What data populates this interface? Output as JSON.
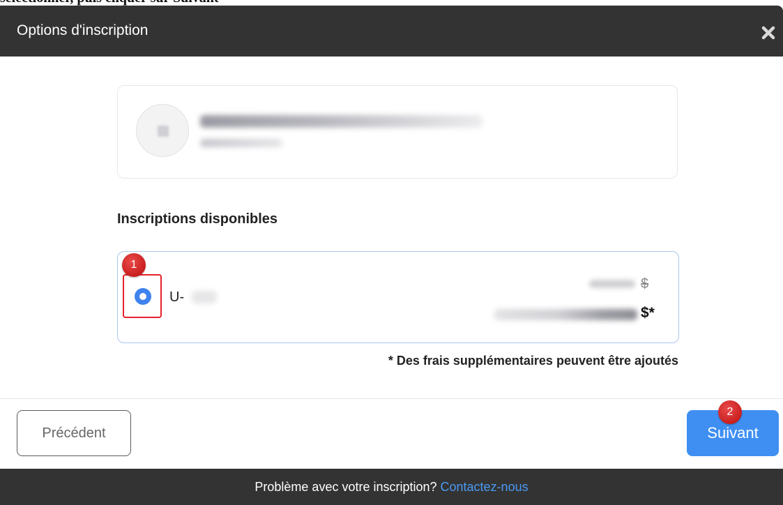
{
  "top_strip": {
    "text": "sélectionner, puis cliquer sur Suivant"
  },
  "modal": {
    "title": "Options d'inscription",
    "close_icon": "close-icon"
  },
  "user_card": {
    "avatar_icon": "avatar"
  },
  "registrations": {
    "section_title": "Inscriptions disponibles",
    "options": [
      {
        "code_prefix": "U-",
        "old_price_currency": "$",
        "new_price_currency": "$*",
        "selected": true
      }
    ],
    "fees_note": "* Des frais supplémentaires peuvent être ajoutés"
  },
  "annotations": {
    "badge_1": "1",
    "badge_2": "2"
  },
  "actions": {
    "previous_label": "Précédent",
    "next_label": "Suivant"
  },
  "footer": {
    "text": "Problème avec votre inscription? ",
    "link": "Contactez-nous"
  },
  "colors": {
    "header": "#333333",
    "primary": "#3f8ff2",
    "link": "#4a9af5",
    "highlight": "#e5202b"
  }
}
